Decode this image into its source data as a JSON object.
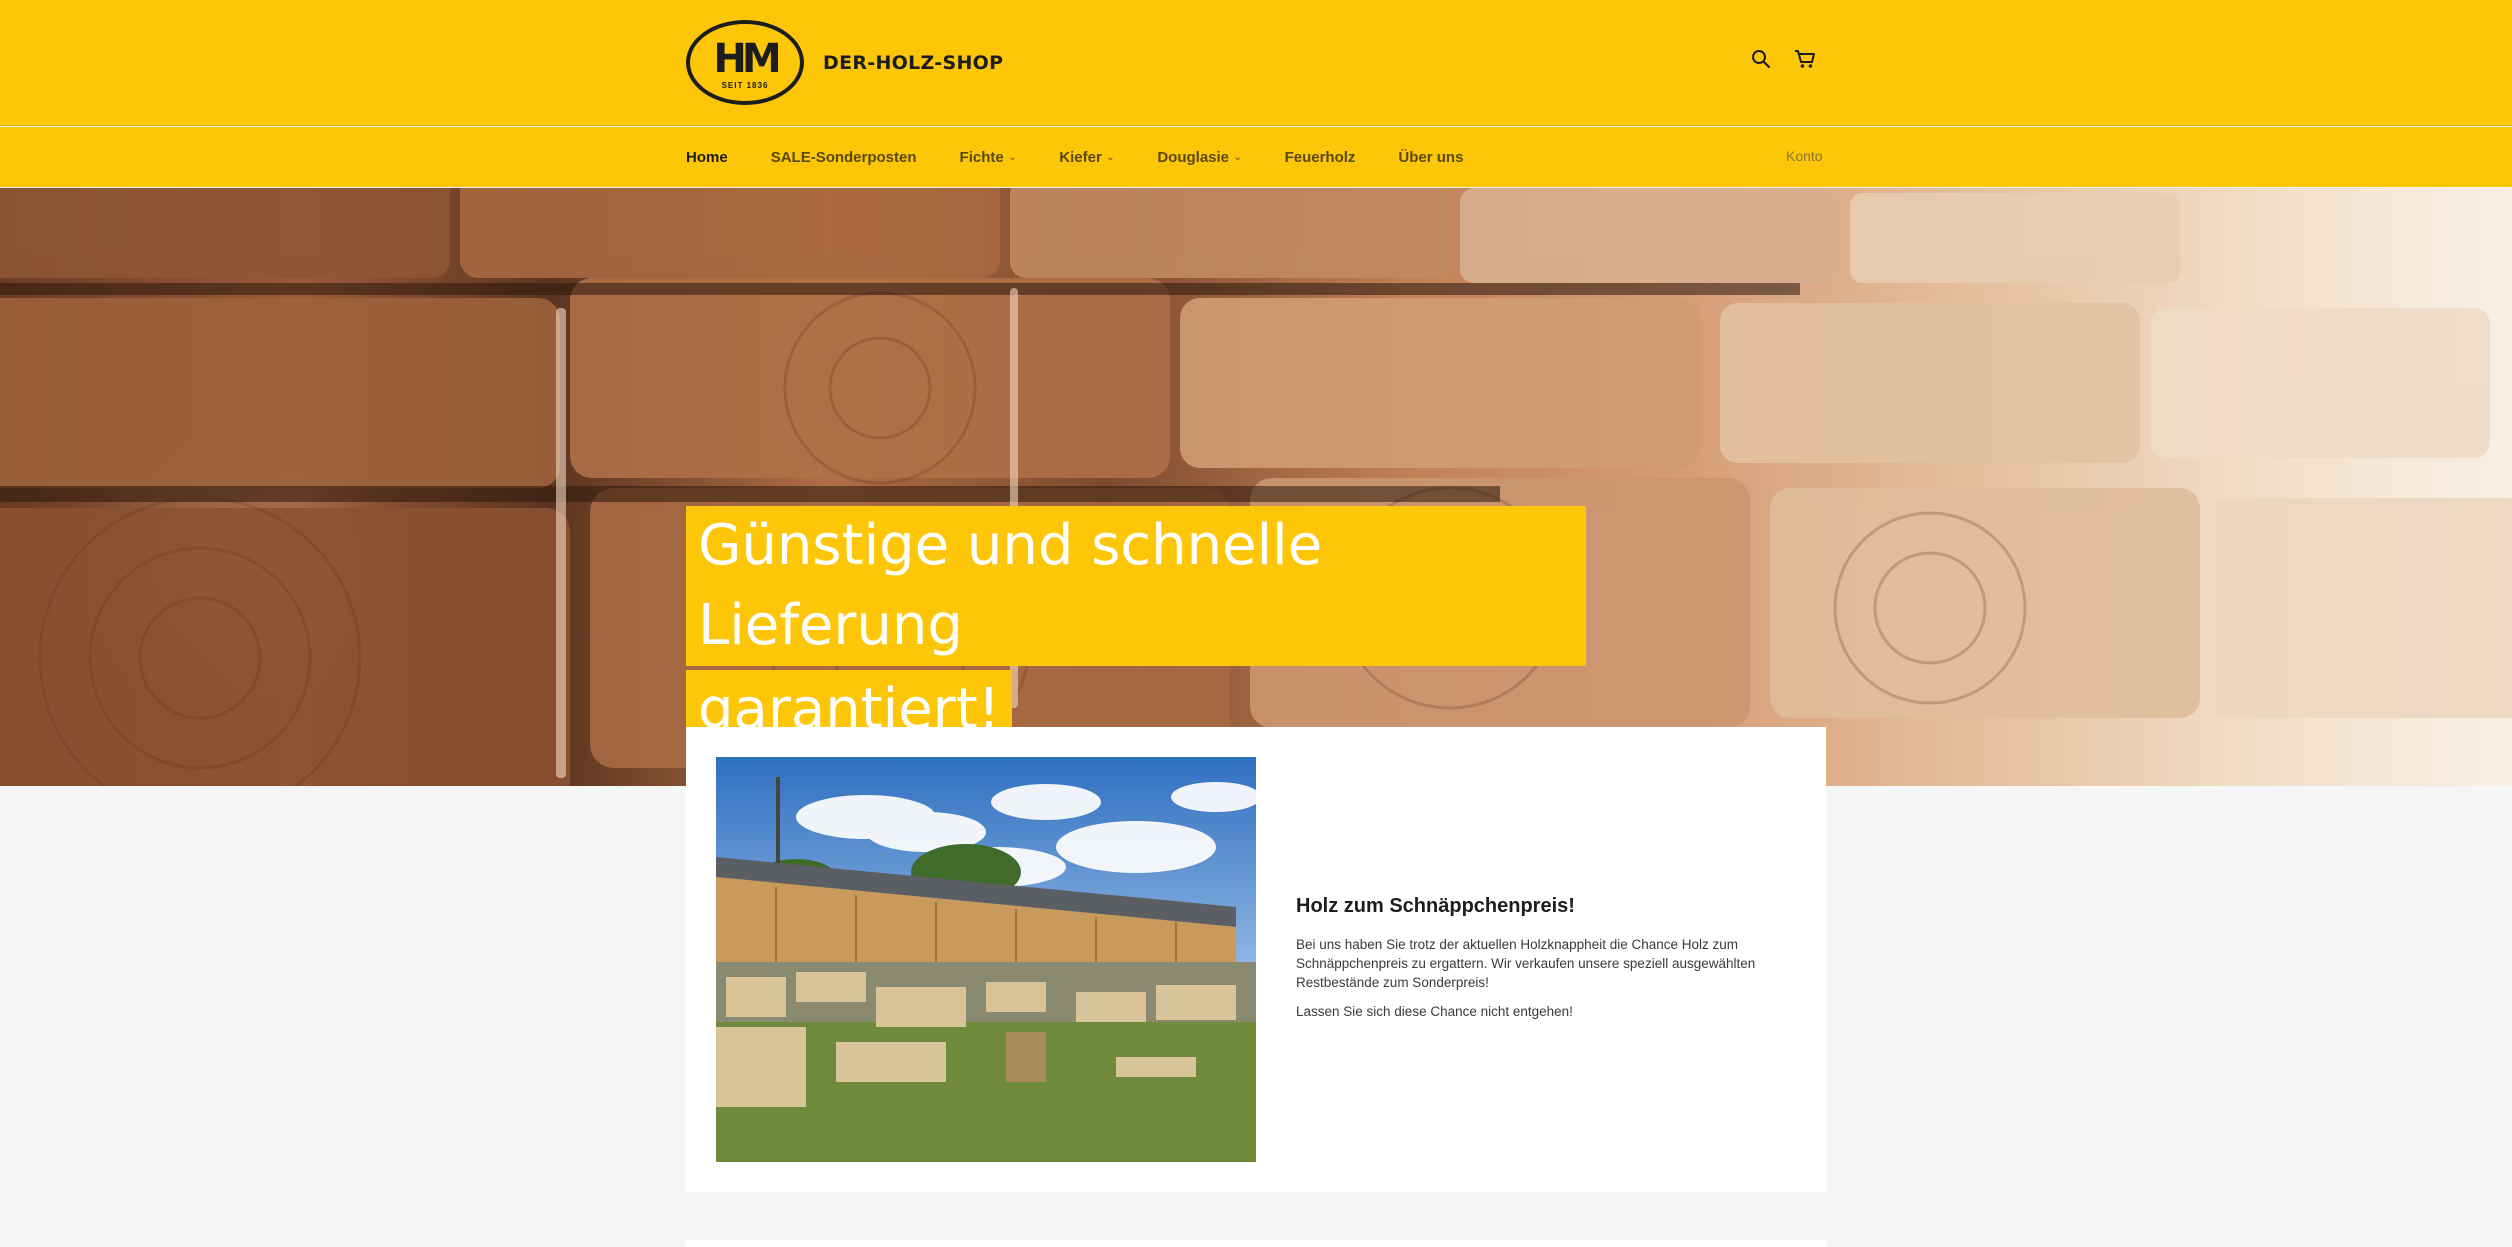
{
  "header": {
    "logo_mark": "HM",
    "logo_since": "SEIT 1836",
    "shop_name": "DER-HOLZ-SHOP",
    "icons": [
      "search-icon",
      "cart-icon"
    ]
  },
  "nav": {
    "items": [
      {
        "label": "Home",
        "active": true,
        "dropdown": false
      },
      {
        "label": "SALE-Sonderposten",
        "active": false,
        "dropdown": false
      },
      {
        "label": "Fichte",
        "active": false,
        "dropdown": true
      },
      {
        "label": "Kiefer",
        "active": false,
        "dropdown": true
      },
      {
        "label": "Douglasie",
        "active": false,
        "dropdown": true
      },
      {
        "label": "Feuerholz",
        "active": false,
        "dropdown": false
      },
      {
        "label": "Über uns",
        "active": false,
        "dropdown": false
      }
    ],
    "account_label": "Konto"
  },
  "hero": {
    "line1": "Günstige und schnelle Lieferung",
    "line2": "garantiert!"
  },
  "feature": {
    "title": "Holz zum Schnäppchenpreis!",
    "paragraph1": "Bei uns haben Sie trotz der aktuellen Holzknappheit die Chance Holz zum Schnäppchenpreis zu ergattern. Wir verkaufen unsere speziell ausgewählten Restbestände zum Sonderpreis!",
    "paragraph2": "Lassen Sie sich diese Chance nicht entgehen!"
  },
  "colors": {
    "brand_yellow": "#fec609",
    "text_dark": "#1c1d1d",
    "page_bg": "#f6f6f6"
  }
}
